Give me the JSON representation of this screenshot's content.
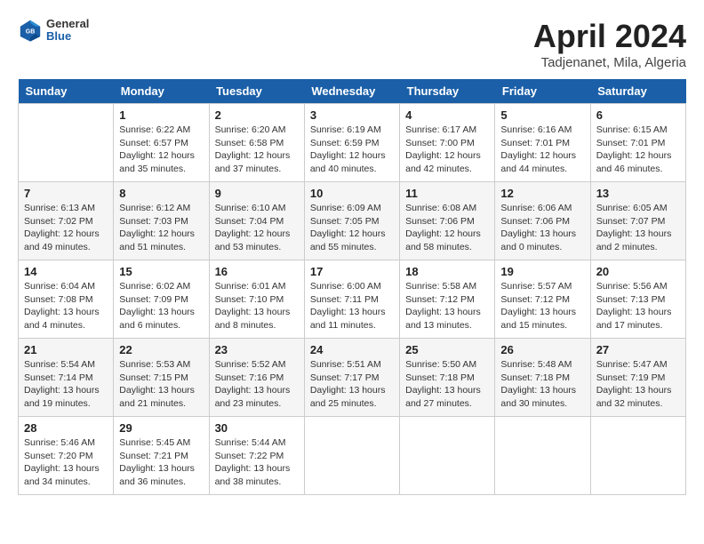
{
  "header": {
    "logo": {
      "general": "General",
      "blue": "Blue"
    },
    "title": "April 2024",
    "location": "Tadjenanet, Mila, Algeria"
  },
  "weekdays": [
    "Sunday",
    "Monday",
    "Tuesday",
    "Wednesday",
    "Thursday",
    "Friday",
    "Saturday"
  ],
  "weeks": [
    [
      {
        "day": "",
        "info": ""
      },
      {
        "day": "1",
        "info": "Sunrise: 6:22 AM\nSunset: 6:57 PM\nDaylight: 12 hours\nand 35 minutes."
      },
      {
        "day": "2",
        "info": "Sunrise: 6:20 AM\nSunset: 6:58 PM\nDaylight: 12 hours\nand 37 minutes."
      },
      {
        "day": "3",
        "info": "Sunrise: 6:19 AM\nSunset: 6:59 PM\nDaylight: 12 hours\nand 40 minutes."
      },
      {
        "day": "4",
        "info": "Sunrise: 6:17 AM\nSunset: 7:00 PM\nDaylight: 12 hours\nand 42 minutes."
      },
      {
        "day": "5",
        "info": "Sunrise: 6:16 AM\nSunset: 7:01 PM\nDaylight: 12 hours\nand 44 minutes."
      },
      {
        "day": "6",
        "info": "Sunrise: 6:15 AM\nSunset: 7:01 PM\nDaylight: 12 hours\nand 46 minutes."
      }
    ],
    [
      {
        "day": "7",
        "info": "Sunrise: 6:13 AM\nSunset: 7:02 PM\nDaylight: 12 hours\nand 49 minutes."
      },
      {
        "day": "8",
        "info": "Sunrise: 6:12 AM\nSunset: 7:03 PM\nDaylight: 12 hours\nand 51 minutes."
      },
      {
        "day": "9",
        "info": "Sunrise: 6:10 AM\nSunset: 7:04 PM\nDaylight: 12 hours\nand 53 minutes."
      },
      {
        "day": "10",
        "info": "Sunrise: 6:09 AM\nSunset: 7:05 PM\nDaylight: 12 hours\nand 55 minutes."
      },
      {
        "day": "11",
        "info": "Sunrise: 6:08 AM\nSunset: 7:06 PM\nDaylight: 12 hours\nand 58 minutes."
      },
      {
        "day": "12",
        "info": "Sunrise: 6:06 AM\nSunset: 7:06 PM\nDaylight: 13 hours\nand 0 minutes."
      },
      {
        "day": "13",
        "info": "Sunrise: 6:05 AM\nSunset: 7:07 PM\nDaylight: 13 hours\nand 2 minutes."
      }
    ],
    [
      {
        "day": "14",
        "info": "Sunrise: 6:04 AM\nSunset: 7:08 PM\nDaylight: 13 hours\nand 4 minutes."
      },
      {
        "day": "15",
        "info": "Sunrise: 6:02 AM\nSunset: 7:09 PM\nDaylight: 13 hours\nand 6 minutes."
      },
      {
        "day": "16",
        "info": "Sunrise: 6:01 AM\nSunset: 7:10 PM\nDaylight: 13 hours\nand 8 minutes."
      },
      {
        "day": "17",
        "info": "Sunrise: 6:00 AM\nSunset: 7:11 PM\nDaylight: 13 hours\nand 11 minutes."
      },
      {
        "day": "18",
        "info": "Sunrise: 5:58 AM\nSunset: 7:12 PM\nDaylight: 13 hours\nand 13 minutes."
      },
      {
        "day": "19",
        "info": "Sunrise: 5:57 AM\nSunset: 7:12 PM\nDaylight: 13 hours\nand 15 minutes."
      },
      {
        "day": "20",
        "info": "Sunrise: 5:56 AM\nSunset: 7:13 PM\nDaylight: 13 hours\nand 17 minutes."
      }
    ],
    [
      {
        "day": "21",
        "info": "Sunrise: 5:54 AM\nSunset: 7:14 PM\nDaylight: 13 hours\nand 19 minutes."
      },
      {
        "day": "22",
        "info": "Sunrise: 5:53 AM\nSunset: 7:15 PM\nDaylight: 13 hours\nand 21 minutes."
      },
      {
        "day": "23",
        "info": "Sunrise: 5:52 AM\nSunset: 7:16 PM\nDaylight: 13 hours\nand 23 minutes."
      },
      {
        "day": "24",
        "info": "Sunrise: 5:51 AM\nSunset: 7:17 PM\nDaylight: 13 hours\nand 25 minutes."
      },
      {
        "day": "25",
        "info": "Sunrise: 5:50 AM\nSunset: 7:18 PM\nDaylight: 13 hours\nand 27 minutes."
      },
      {
        "day": "26",
        "info": "Sunrise: 5:48 AM\nSunset: 7:18 PM\nDaylight: 13 hours\nand 30 minutes."
      },
      {
        "day": "27",
        "info": "Sunrise: 5:47 AM\nSunset: 7:19 PM\nDaylight: 13 hours\nand 32 minutes."
      }
    ],
    [
      {
        "day": "28",
        "info": "Sunrise: 5:46 AM\nSunset: 7:20 PM\nDaylight: 13 hours\nand 34 minutes."
      },
      {
        "day": "29",
        "info": "Sunrise: 5:45 AM\nSunset: 7:21 PM\nDaylight: 13 hours\nand 36 minutes."
      },
      {
        "day": "30",
        "info": "Sunrise: 5:44 AM\nSunset: 7:22 PM\nDaylight: 13 hours\nand 38 minutes."
      },
      {
        "day": "",
        "info": ""
      },
      {
        "day": "",
        "info": ""
      },
      {
        "day": "",
        "info": ""
      },
      {
        "day": "",
        "info": ""
      }
    ]
  ]
}
